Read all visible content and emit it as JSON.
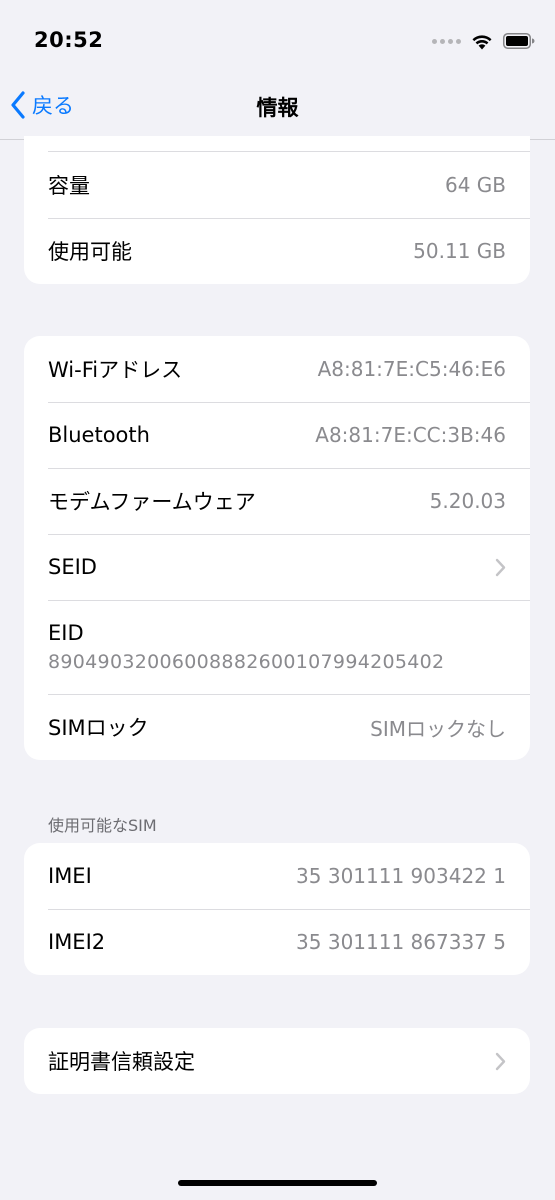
{
  "status_bar": {
    "time": "20:52"
  },
  "nav": {
    "back_label": "戻る",
    "title": "情報"
  },
  "storage": [
    {
      "label": "容量",
      "value": "64 GB"
    },
    {
      "label": "使用可能",
      "value": "50.11 GB"
    }
  ],
  "network": {
    "wifi": {
      "label": "Wi-Fiアドレス",
      "value": "A8:81:7E:C5:46:E6"
    },
    "bluetooth": {
      "label": "Bluetooth",
      "value": "A8:81:7E:CC:3B:46"
    },
    "modem": {
      "label": "モデムファームウェア",
      "value": "5.20.03"
    },
    "seid": {
      "label": "SEID"
    },
    "eid": {
      "label": "EID",
      "value": "89049032006008882600107994205402"
    },
    "simlock": {
      "label": "SIMロック",
      "value": "SIMロックなし"
    }
  },
  "sim_section": {
    "header": "使用可能なSIM",
    "imei": {
      "label": "IMEI",
      "value": "35 301111 903422 1"
    },
    "imei2": {
      "label": "IMEI2",
      "value": "35 301111 867337 5"
    }
  },
  "certificates": {
    "label": "証明書信頼設定"
  },
  "colors": {
    "accent": "#0a7aff",
    "background": "#f2f2f7",
    "secondary_text": "#8a8a8e"
  },
  "icons": {
    "back": "chevron-left-icon",
    "disclosure": "chevron-right-icon",
    "wifi": "wifi-icon",
    "battery": "battery-icon"
  }
}
